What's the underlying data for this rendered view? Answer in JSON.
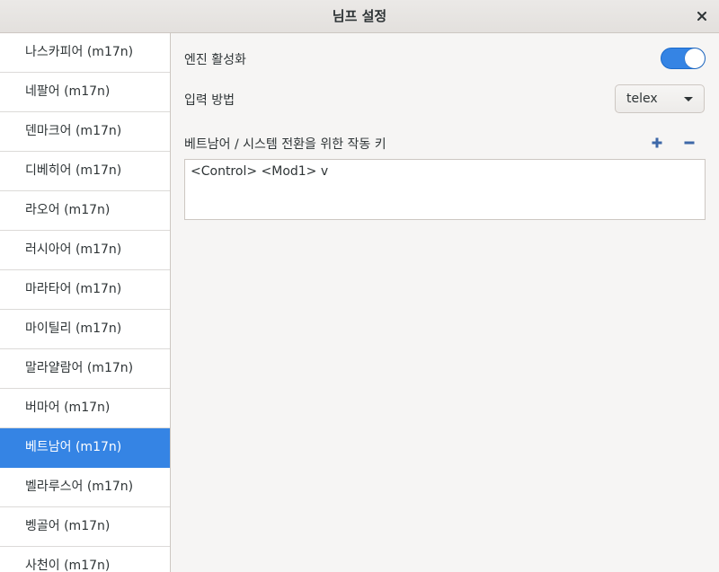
{
  "window": {
    "title": "님프 설정"
  },
  "sidebar": {
    "items": [
      {
        "label": "나스카피어 (m17n)"
      },
      {
        "label": "네팔어 (m17n)"
      },
      {
        "label": "덴마크어 (m17n)"
      },
      {
        "label": "디베히어 (m17n)"
      },
      {
        "label": "라오어 (m17n)"
      },
      {
        "label": "러시아어 (m17n)"
      },
      {
        "label": "마라타어 (m17n)"
      },
      {
        "label": "마이틸리 (m17n)"
      },
      {
        "label": "말라얄람어 (m17n)"
      },
      {
        "label": "버마어 (m17n)"
      },
      {
        "label": "베트남어 (m17n)",
        "selected": true
      },
      {
        "label": "벨라루스어 (m17n)"
      },
      {
        "label": "벵골어 (m17n)"
      },
      {
        "label": "사천이 (m17n)"
      }
    ]
  },
  "settings": {
    "engine_label": "엔진 활성화",
    "engine_enabled": true,
    "method_label": "입력 방법",
    "method_value": "telex",
    "hotkey_label": "베트남어 / 시스템 전환을 위한 작동 키",
    "hotkeys": [
      "<Control> <Mod1> v"
    ]
  },
  "icons": {
    "add": "plus-icon",
    "remove": "minus-icon",
    "close": "close-icon"
  },
  "colors": {
    "accent": "#3584e4"
  }
}
